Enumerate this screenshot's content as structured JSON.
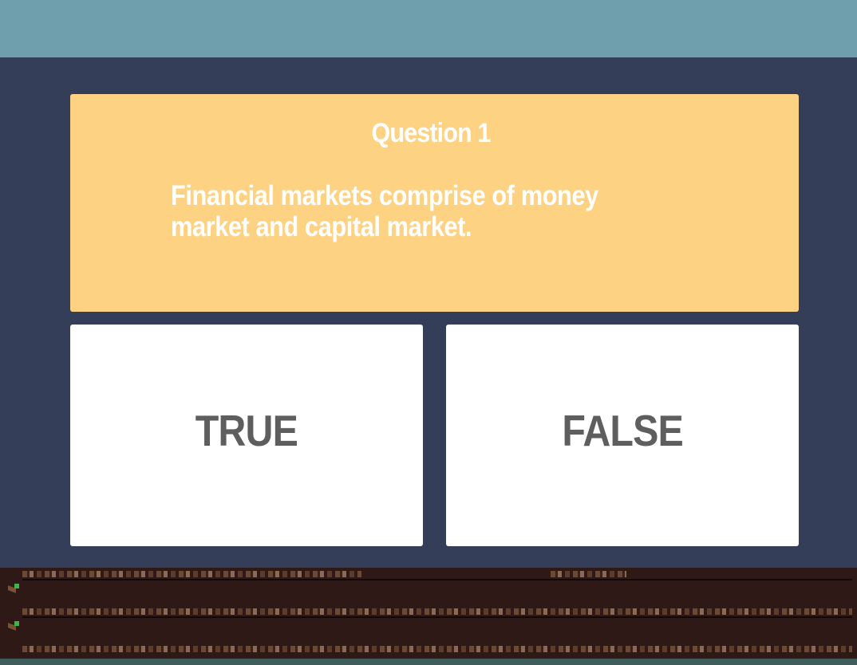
{
  "quiz": {
    "question_number": "Question 1",
    "question_text": "Financial markets comprise of money market and capital market.",
    "answers": [
      {
        "label": "TRUE"
      },
      {
        "label": "FALSE"
      }
    ]
  },
  "colors": {
    "sky": "#6f9fac",
    "panel": "#353e58",
    "question_card": "#fed283",
    "answer_card": "#ffffff",
    "answer_text": "#5e5e5e",
    "ground": "#2e1916"
  },
  "icons": [
    "sprout-icon",
    "sprout-icon"
  ]
}
